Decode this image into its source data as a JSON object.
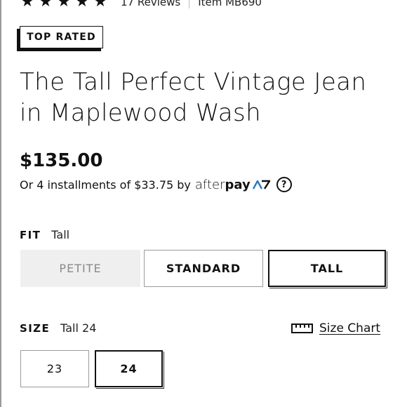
{
  "rating": {
    "stars": 5,
    "reviews_text": "17 Reviews",
    "item_text": "Item MB690"
  },
  "badge": {
    "label": "TOP RATED"
  },
  "product": {
    "title_line1": "The Tall Perfect Vintage Jean",
    "title_line2": "in Maplewood Wash",
    "price": "$135.00"
  },
  "afterpay": {
    "installments_text": "Or 4 installments of $33.75 by",
    "logo_after": "after",
    "logo_pay": "pay",
    "help_glyph": "?"
  },
  "fit": {
    "label": "FIT",
    "selected_value": "Tall",
    "options": [
      {
        "label": "PETITE",
        "state": "disabled"
      },
      {
        "label": "STANDARD",
        "state": "available"
      },
      {
        "label": "TALL",
        "state": "selected"
      }
    ]
  },
  "size": {
    "label": "SIZE",
    "selected_value": "Tall 24",
    "size_chart_label": "Size Chart",
    "options": [
      {
        "label": "23",
        "state": "available"
      },
      {
        "label": "24",
        "state": "selected"
      }
    ]
  },
  "icons": {
    "star": "star-icon",
    "ruler": "ruler-icon",
    "help": "question-circle-icon"
  },
  "colors": {
    "text": "#111111",
    "disabled_bg": "#efefef",
    "afterpay_teal": "#2b7bbf"
  }
}
